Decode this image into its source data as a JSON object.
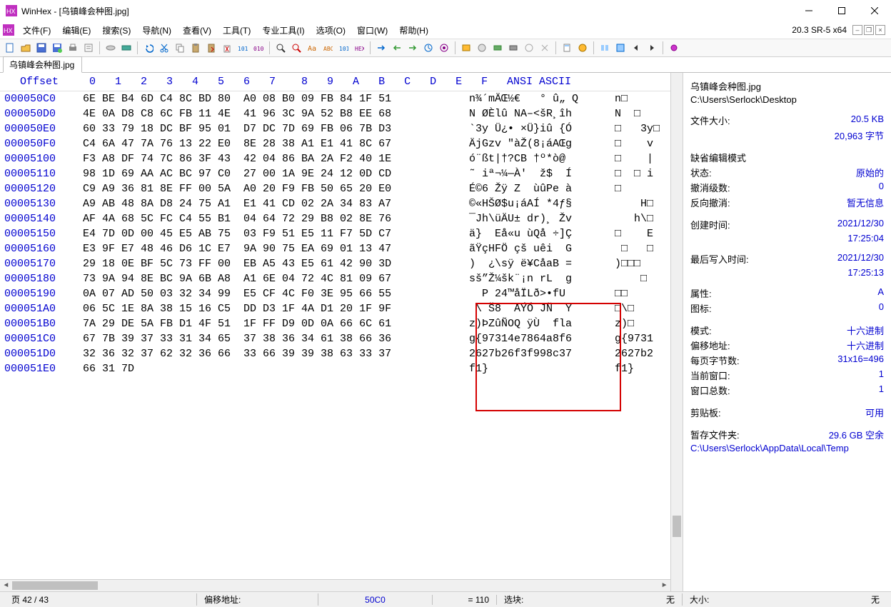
{
  "window": {
    "title": "WinHex - [乌镇峰会种图.jpg]",
    "version": "20.3 SR-5 x64"
  },
  "menus": [
    "文件(F)",
    "编辑(E)",
    "搜索(S)",
    "导航(N)",
    "查看(V)",
    "工具(T)",
    "专业工具(I)",
    "选项(O)",
    "窗口(W)",
    "帮助(H)"
  ],
  "tab": "乌镇峰会种图.jpg",
  "header": {
    "offset": "Offset",
    "hex": " 0   1   2   3   4   5   6   7    8   9   A   B   C   D   E   F",
    "ascii": "ANSI ASCII",
    "extra": ""
  },
  "rows": [
    {
      "off": "000050C0",
      "hx": "6E BE B4 6D C4 8C BD 80  A0 08 B0 09 FB 84 1F 51",
      "asc": "n¾´mÄŒ½€   ° û„ Q",
      "ext": "n□     "
    },
    {
      "off": "000050D0",
      "hx": "4E 0A D8 C8 6C FB 11 4E  41 96 3C 9A 52 B8 EE 68",
      "asc": "N ØÈlû NA–<šR¸îh",
      "ext": "N  □   "
    },
    {
      "off": "000050E0",
      "hx": "60 33 79 18 DC BF 95 01  D7 DC 7D 69 FB 06 7B D3",
      "asc": "`3y Ü¿• ×Ü}iû {Ó",
      "ext": "□   3y□"
    },
    {
      "off": "000050F0",
      "hx": "C4 6A 47 7A 76 13 22 E0  8E 28 38 A1 E1 41 8C 67",
      "asc": "ÄjGzv \"àŽ(8¡áAŒg",
      "ext": "□    v "
    },
    {
      "off": "00005100",
      "hx": "F3 A8 DF 74 7C 86 3F 43  42 04 86 BA 2A F2 40 1E",
      "asc": "ó¨ßt|†?CB †º*ò@ ",
      "ext": "□    | "
    },
    {
      "off": "00005110",
      "hx": "98 1D 69 AA AC BC 97 C0  27 00 1A 9E 24 12 0D CD",
      "asc": "˜ iª¬¼—À'  ž$  Í",
      "ext": "□  □ i "
    },
    {
      "off": "00005120",
      "hx": "C9 A9 36 81 8E FF 00 5A  A0 20 F9 FB 50 65 20 E0",
      "asc": "É©6 Žÿ Z  ùûPe à",
      "ext": "□      "
    },
    {
      "off": "00005130",
      "hx": "A9 AB 48 8A D8 24 75 A1  E1 41 CD 02 2A 34 83 A7",
      "asc": "©«HŠØ$u¡áAÍ *4ƒ§",
      "ext": "    H□ "
    },
    {
      "off": "00005140",
      "hx": "AF 4A 68 5C FC C4 55 B1  04 64 72 29 B8 02 8E 76",
      "asc": "¯Jh\\üÄU± dr)¸ Žv",
      "ext": "   h\\□ "
    },
    {
      "off": "00005150",
      "hx": "E4 7D 0D 00 45 E5 AB 75  03 F9 51 E5 11 F7 5D C7",
      "asc": "ä}  Eå«u ùQå ÷]Ç",
      "ext": "□    E "
    },
    {
      "off": "00005160",
      "hx": "E3 9F E7 48 46 D6 1C E7  9A 90 75 EA 69 01 13 47",
      "asc": "ãŸçHFÖ çš uêi  G",
      "ext": " □   □ "
    },
    {
      "off": "00005170",
      "hx": "29 18 0E BF 5C 73 FF 00  EB A5 43 E5 61 42 90 3D",
      "asc": ")  ¿\\sÿ ë¥CåaB =",
      "ext": ")□□□   "
    },
    {
      "off": "00005180",
      "hx": "73 9A 94 8E BC 9A 6B A8  A1 6E 04 72 4C 81 09 67",
      "asc": "sš”Ž¼šk¨¡n rL  g",
      "ext": "    □  "
    },
    {
      "off": "00005190",
      "hx": "0A 07 AD 50 03 32 34 99  E5 CF 4C F0 3E 95 66 55",
      "asc": "  ­P 24™åÏLð>•fU",
      "ext": "□□     "
    },
    {
      "off": "000051A0",
      "hx": "06 5C 1E 8A 38 15 16 C5  DD D3 1F 4A D1 20 1F 9F",
      "asc": " \\ Š8  ÅÝÓ JÑ  Ÿ",
      "ext": "□\\□    "
    },
    {
      "off": "000051B0",
      "hx": "7A 29 DE 5A FB D1 4F 51  1F FF D9 0D 0A 66 6C 61",
      "asc": "z)ÞZûÑOQ ÿÙ  fla",
      "ext": "z)□    "
    },
    {
      "off": "000051C0",
      "hx": "67 7B 39 37 33 31 34 65  37 38 36 34 61 38 66 36",
      "asc": "g{97314e7864a8f6",
      "ext": "g{9731 "
    },
    {
      "off": "000051D0",
      "hx": "32 36 32 37 62 32 36 66  33 66 39 39 38 63 33 37",
      "asc": "2627b26f3f998c37",
      "ext": "2627b2 "
    },
    {
      "off": "000051E0",
      "hx": "66 31 7D                                        ",
      "asc": "f1}             ",
      "ext": "f1}    "
    }
  ],
  "side": {
    "filename": "乌镇峰会种图.jpg",
    "path": "C:\\Users\\Serlock\\Desktop",
    "size_label": "文件大小:",
    "size_value": "20.5 KB",
    "size_bytes": "20,963 字节",
    "mode_section": "缺省编辑模式",
    "state_label": "状态:",
    "state_value": "原始的",
    "undo_label": "撤消级数:",
    "undo_value": "0",
    "redo_label": "反向撤消:",
    "redo_value": "暂无信息",
    "created_label": "创建时间:",
    "created_date": "2021/12/30",
    "created_time": "17:25:04",
    "modified_label": "最后写入时间:",
    "modified_date": "2021/12/30",
    "modified_time": "17:25:13",
    "attr_label": "属性:",
    "attr_value": "A",
    "icon_label": "图标:",
    "icon_value": "0",
    "disp_mode_label": "模式:",
    "disp_mode_value": "十六进制",
    "offaddr_label": "偏移地址:",
    "offaddr_value": "十六进制",
    "bpp_label": "每页字节数:",
    "bpp_value": "31x16=496",
    "curwin_label": "当前窗口:",
    "curwin_value": "1",
    "wincount_label": "窗口总数:",
    "wincount_value": "1",
    "clip_label": "剪贴板:",
    "clip_value": "可用",
    "temp_label": "暂存文件夹:",
    "temp_value": "29.6 GB 空余",
    "temp_path": "C:\\Users\\Serlock\\AppData\\Local\\Temp"
  },
  "status": {
    "page": "页 42 / 43",
    "off_label": "偏移地址:",
    "off_value": "50C0",
    "eq": "= 110",
    "sel_label": "选块:",
    "sel_value": "无",
    "size_label": "大小:",
    "size_value": "无"
  }
}
